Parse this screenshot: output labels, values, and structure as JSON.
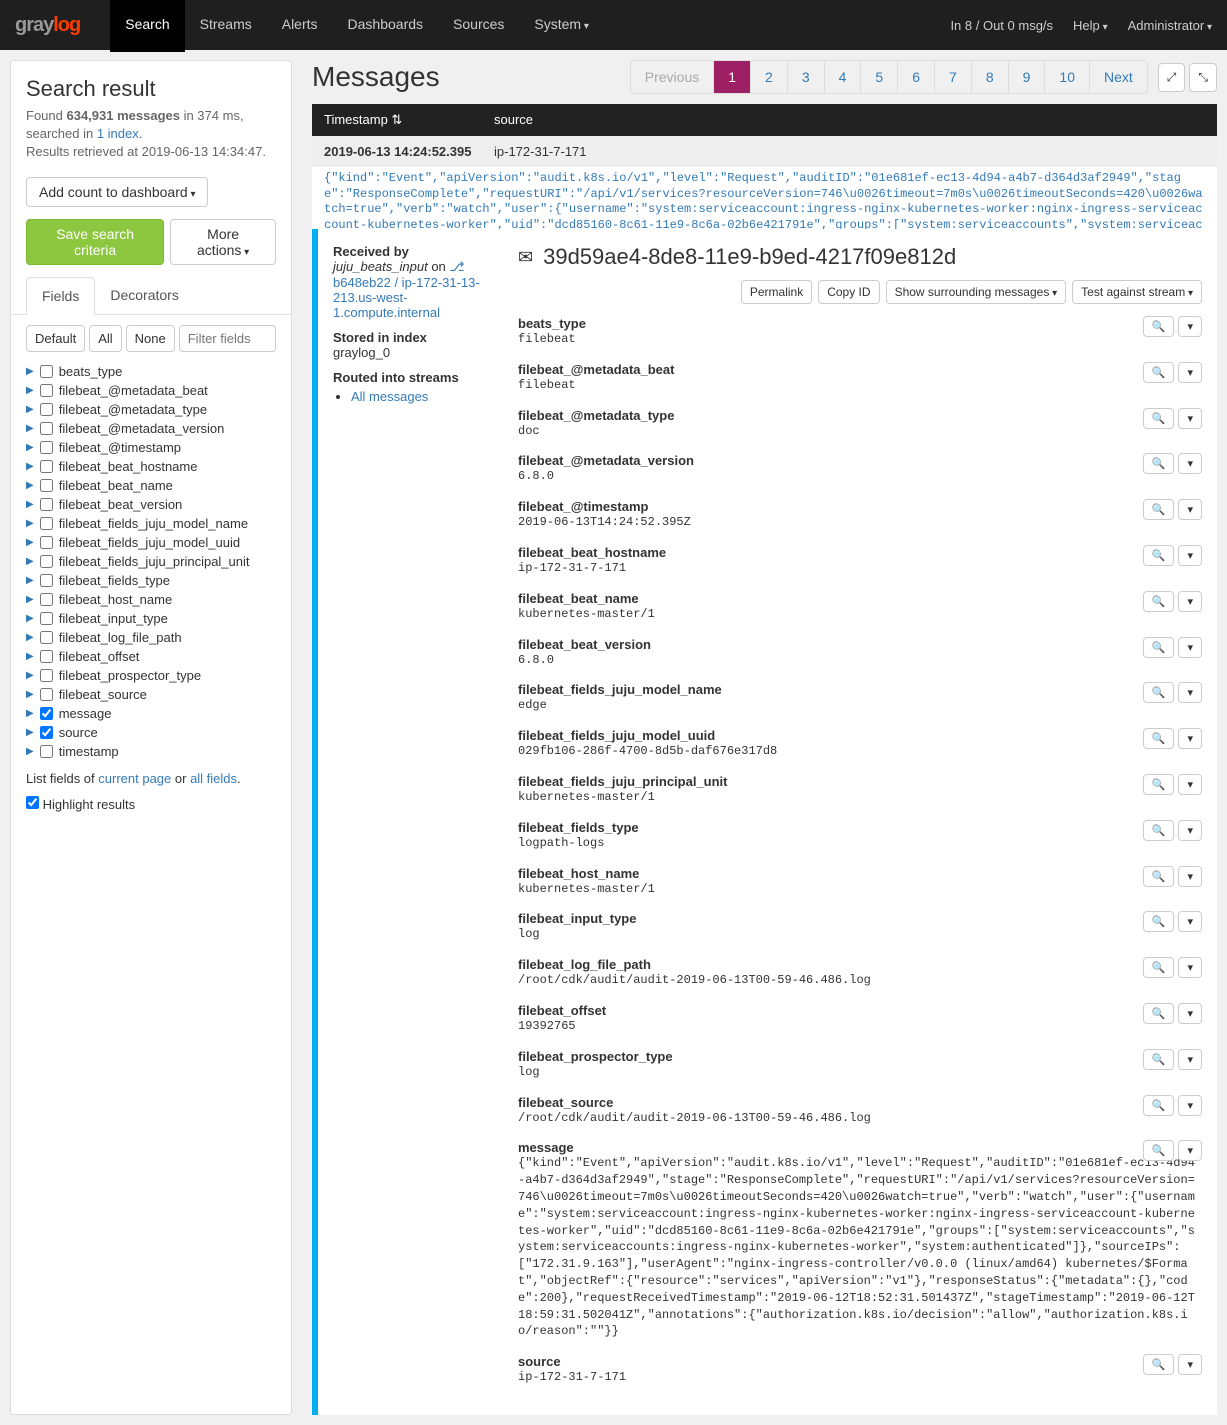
{
  "nav": {
    "items": [
      "Search",
      "Streams",
      "Alerts",
      "Dashboards",
      "Sources",
      "System"
    ],
    "active": "Search",
    "io_text": "In 8 / Out 0 msg/s",
    "help": "Help",
    "admin": "Administrator"
  },
  "sidebar": {
    "title": "Search result",
    "found_pre": "Found ",
    "found_count": "634,931 messages",
    "found_mid": " in 374 ms, searched in ",
    "index_link": "1 index",
    "retrieved": "Results retrieved at 2019-06-13 14:34:47.",
    "add_dash": "Add count to dashboard",
    "save_criteria": "Save search criteria",
    "more_actions": "More actions",
    "tabs": [
      "Fields",
      "Decorators"
    ],
    "filter_buttons": [
      "Default",
      "All",
      "None"
    ],
    "filter_placeholder": "Filter fields",
    "fields": [
      {
        "name": "beats_type",
        "checked": false
      },
      {
        "name": "filebeat_@metadata_beat",
        "checked": false
      },
      {
        "name": "filebeat_@metadata_type",
        "checked": false
      },
      {
        "name": "filebeat_@metadata_version",
        "checked": false
      },
      {
        "name": "filebeat_@timestamp",
        "checked": false
      },
      {
        "name": "filebeat_beat_hostname",
        "checked": false
      },
      {
        "name": "filebeat_beat_name",
        "checked": false
      },
      {
        "name": "filebeat_beat_version",
        "checked": false
      },
      {
        "name": "filebeat_fields_juju_model_name",
        "checked": false
      },
      {
        "name": "filebeat_fields_juju_model_uuid",
        "checked": false
      },
      {
        "name": "filebeat_fields_juju_principal_unit",
        "checked": false
      },
      {
        "name": "filebeat_fields_type",
        "checked": false
      },
      {
        "name": "filebeat_host_name",
        "checked": false
      },
      {
        "name": "filebeat_input_type",
        "checked": false
      },
      {
        "name": "filebeat_log_file_path",
        "checked": false
      },
      {
        "name": "filebeat_offset",
        "checked": false
      },
      {
        "name": "filebeat_prospector_type",
        "checked": false
      },
      {
        "name": "filebeat_source",
        "checked": false
      },
      {
        "name": "message",
        "checked": true
      },
      {
        "name": "source",
        "checked": true
      },
      {
        "name": "timestamp",
        "checked": false
      }
    ],
    "list_footer_pre": "List fields of ",
    "list_footer_a": "current page",
    "list_footer_or": " or ",
    "list_footer_b": "all fields",
    "highlight": "Highlight results"
  },
  "main": {
    "title": "Messages",
    "pager": [
      "Previous",
      "1",
      "2",
      "3",
      "4",
      "5",
      "6",
      "7",
      "8",
      "9",
      "10",
      "Next"
    ],
    "th_ts": "Timestamp",
    "th_src": "source",
    "row_ts": "2019-06-13 14:24:52.395",
    "row_src": "ip-172-31-7-171",
    "preview": "{\"kind\":\"Event\",\"apiVersion\":\"audit.k8s.io/v1\",\"level\":\"Request\",\"auditID\":\"01e681ef-ec13-4d94-a4b7-d364d3af2949\",\"stage\":\"ResponseComplete\",\"requestURI\":\"/api/v1/services?resourceVersion=746\\u0026timeout=7m0s\\u0026timeoutSeconds=420\\u0026watch=true\",\"verb\":\"watch\",\"user\":{\"username\":\"system:serviceaccount:ingress-nginx-kubernetes-worker:nginx-ingress-serviceaccount-kubernetes-worker\",\"uid\":\"dcd85160-8c61-11e9-8c6a-02b6e421791e\",\"groups\":[\"system:serviceaccounts\",\"system:serviceaccounts:ingress-nginx-kubernetes-worke",
    "msg_id": "39d59ae4-8de8-11e9-b9ed-4217f09e812d",
    "actions": {
      "permalink": "Permalink",
      "copy": "Copy ID",
      "surround": "Show surrounding messages",
      "test": "Test against stream"
    },
    "received_by_label": "Received by",
    "received_by_input": "juju_beats_input",
    "received_by_on": " on ",
    "received_by_host": "b648eb22 / ip-172-31-13-213.us-west-1.compute.internal",
    "stored_label": "Stored in index",
    "stored_val": "graylog_0",
    "routed_label": "Routed into streams",
    "routed_stream": "All messages",
    "fields": [
      {
        "name": "beats_type",
        "val": "filebeat"
      },
      {
        "name": "filebeat_@metadata_beat",
        "val": "filebeat"
      },
      {
        "name": "filebeat_@metadata_type",
        "val": "doc"
      },
      {
        "name": "filebeat_@metadata_version",
        "val": "6.8.0"
      },
      {
        "name": "filebeat_@timestamp",
        "val": "2019-06-13T14:24:52.395Z"
      },
      {
        "name": "filebeat_beat_hostname",
        "val": "ip-172-31-7-171"
      },
      {
        "name": "filebeat_beat_name",
        "val": "kubernetes-master/1"
      },
      {
        "name": "filebeat_beat_version",
        "val": "6.8.0"
      },
      {
        "name": "filebeat_fields_juju_model_name",
        "val": "edge"
      },
      {
        "name": "filebeat_fields_juju_model_uuid",
        "val": "029fb106-286f-4700-8d5b-daf676e317d8"
      },
      {
        "name": "filebeat_fields_juju_principal_unit",
        "val": "kubernetes-master/1"
      },
      {
        "name": "filebeat_fields_type",
        "val": "logpath-logs"
      },
      {
        "name": "filebeat_host_name",
        "val": "kubernetes-master/1"
      },
      {
        "name": "filebeat_input_type",
        "val": "log"
      },
      {
        "name": "filebeat_log_file_path",
        "val": "/root/cdk/audit/audit-2019-06-13T00-59-46.486.log"
      },
      {
        "name": "filebeat_offset",
        "val": "19392765"
      },
      {
        "name": "filebeat_prospector_type",
        "val": "log"
      },
      {
        "name": "filebeat_source",
        "val": "/root/cdk/audit/audit-2019-06-13T00-59-46.486.log"
      },
      {
        "name": "message",
        "val": "{\"kind\":\"Event\",\"apiVersion\":\"audit.k8s.io/v1\",\"level\":\"Request\",\"auditID\":\"01e681ef-ec13-4d94-a4b7-d364d3af2949\",\"stage\":\"ResponseComplete\",\"requestURI\":\"/api/v1/services?resourceVersion=746\\u0026timeout=7m0s\\u0026timeoutSeconds=420\\u0026watch=true\",\"verb\":\"watch\",\"user\":{\"username\":\"system:serviceaccount:ingress-nginx-kubernetes-worker:nginx-ingress-serviceaccount-kubernetes-worker\",\"uid\":\"dcd85160-8c61-11e9-8c6a-02b6e421791e\",\"groups\":[\"system:serviceaccounts\",\"system:serviceaccounts:ingress-nginx-kubernetes-worker\",\"system:authenticated\"]},\"sourceIPs\":[\"172.31.9.163\"],\"userAgent\":\"nginx-ingress-controller/v0.0.0 (linux/amd64) kubernetes/$Format\",\"objectRef\":{\"resource\":\"services\",\"apiVersion\":\"v1\"},\"responseStatus\":{\"metadata\":{},\"code\":200},\"requestReceivedTimestamp\":\"2019-06-12T18:52:31.501437Z\",\"stageTimestamp\":\"2019-06-12T18:59:31.502041Z\",\"annotations\":{\"authorization.k8s.io/decision\":\"allow\",\"authorization.k8s.io/reason\":\"\"}}"
      },
      {
        "name": "source",
        "val": "ip-172-31-7-171"
      }
    ]
  }
}
